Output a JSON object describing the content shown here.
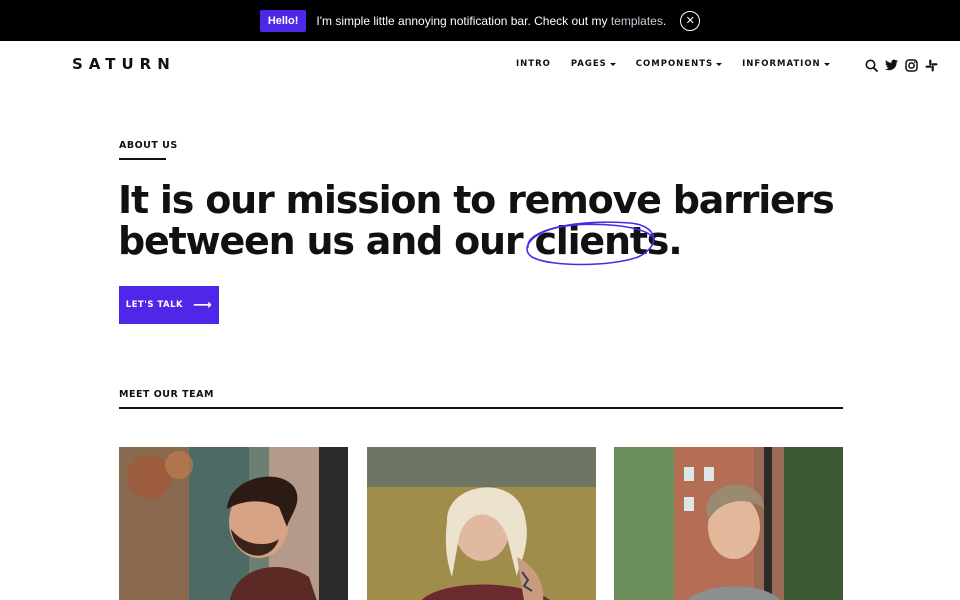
{
  "notification": {
    "badge": "Hello!",
    "message": "I'm simple little annoying notification bar. Check out my ",
    "link": "templates",
    "message_end": ".",
    "close_icon": "close-icon"
  },
  "header": {
    "logo": "SATURN",
    "nav": [
      {
        "label": "INTRO",
        "dropdown": false
      },
      {
        "label": "PAGES",
        "dropdown": true
      },
      {
        "label": "COMPONENTS",
        "dropdown": true
      },
      {
        "label": "INFORMATION",
        "dropdown": true
      }
    ],
    "icons": [
      "search-icon",
      "twitter-icon",
      "instagram-icon",
      "slack-icon"
    ]
  },
  "hero": {
    "eyebrow": "ABOUT US",
    "line1": "It is our mission to remove barriers",
    "line2_pre": "between us and our ",
    "highlight": "clients",
    "line2_post": ".",
    "cta": "LET'S TALK",
    "cta_icon": "arrow-right-icon"
  },
  "team": {
    "title": "MEET OUR TEAM",
    "members": [
      "team-photo-1",
      "team-photo-2",
      "team-photo-3"
    ]
  },
  "colors": {
    "accent": "#4f27e8",
    "notification_bg": "#000000",
    "text": "#111111"
  }
}
